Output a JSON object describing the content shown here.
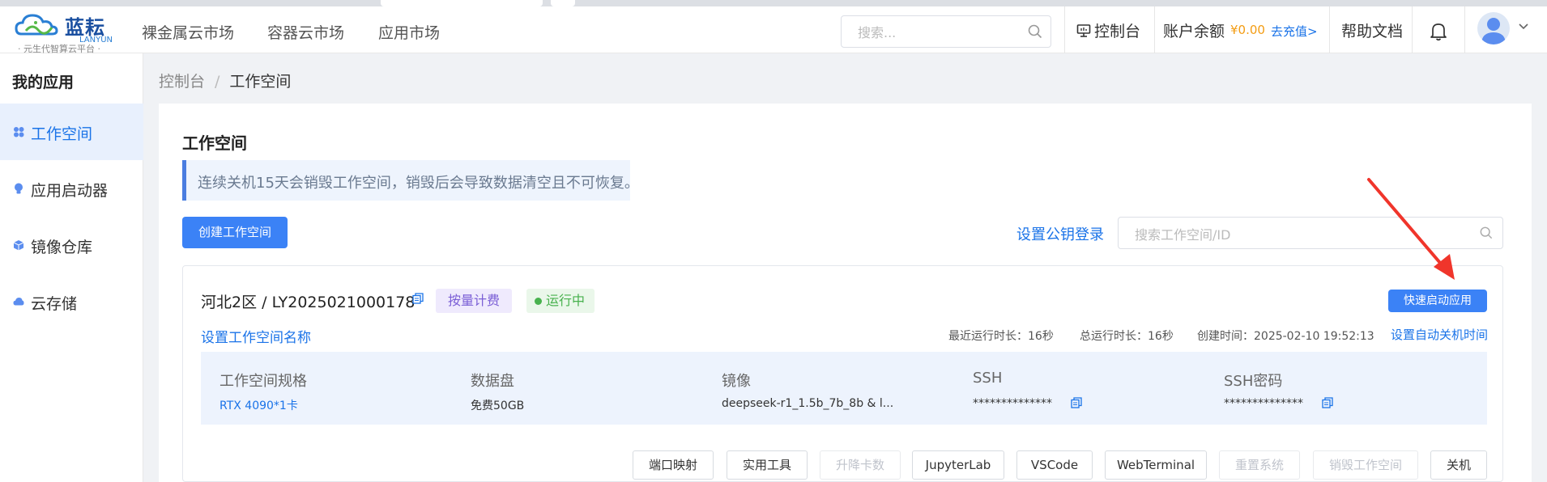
{
  "brand": {
    "name_cn": "蓝耘",
    "name_en": "LANYUN",
    "tagline": "· 元生代智算云平台 ·"
  },
  "header": {
    "nav": [
      "裸金属云市场",
      "容器云市场",
      "应用市场"
    ],
    "search_placeholder": "搜索...",
    "console_label": "控制台",
    "balance_label": "账户余额",
    "balance_amount": "¥0.00",
    "recharge_label": "去充值>",
    "help_label": "帮助文档"
  },
  "sidebar": {
    "title": "我的应用",
    "items": [
      {
        "label": "工作空间",
        "icon": "workspace-icon",
        "active": true
      },
      {
        "label": "应用启动器",
        "icon": "bulb-icon",
        "active": false
      },
      {
        "label": "镜像仓库",
        "icon": "cube-icon",
        "active": false
      },
      {
        "label": "云存储",
        "icon": "cloud-icon",
        "active": false
      }
    ]
  },
  "breadcrumb": {
    "home": "控制台",
    "separator": "/",
    "current": "工作空间"
  },
  "main": {
    "title": "工作空间",
    "notice": "连续关机15天会销毁工作空间，销毁后会导致数据清空且不可恢复。",
    "create_button": "创建工作空间",
    "pubkey_link": "设置公钥登录",
    "search_placeholder": "搜索工作空间/ID"
  },
  "workspace": {
    "name": "河北2区 / LY2025021000178",
    "billing_tag": "按量计费",
    "status": "运行中",
    "quick_start_button": "快速启动应用",
    "set_name_link": "设置工作空间名称",
    "recent_runtime": "最近运行时长：16秒",
    "total_runtime": "总运行时长：16秒",
    "created_at": "创建时间：2025-02-10 19:52:13",
    "auto_shutdown_link": "设置自动关机时间",
    "info": {
      "spec_label": "工作空间规格",
      "spec_value": "RTX 4090*1卡",
      "disk_label": "数据盘",
      "disk_value": "免费50GB",
      "image_label": "镜像",
      "image_value": "deepseek-r1_1.5b_7b_8b & l...",
      "ssh_label": "SSH",
      "ssh_value": "**************",
      "sshpw_label": "SSH密码",
      "sshpw_value": "**************"
    },
    "actions": [
      {
        "label": "端口映射",
        "disabled": false
      },
      {
        "label": "实用工具",
        "disabled": false
      },
      {
        "label": "升降卡数",
        "disabled": true
      },
      {
        "label": "JupyterLab",
        "disabled": false
      },
      {
        "label": "VSCode",
        "disabled": false
      },
      {
        "label": "WebTerminal",
        "disabled": false
      },
      {
        "label": "重置系统",
        "disabled": true
      },
      {
        "label": "销毁工作空间",
        "disabled": true
      },
      {
        "label": "关机",
        "disabled": false
      }
    ]
  },
  "colors": {
    "accent": "#3b82f6",
    "link": "#1a73e8",
    "status_green": "#48b24e",
    "arrow_red": "#f0352b"
  }
}
